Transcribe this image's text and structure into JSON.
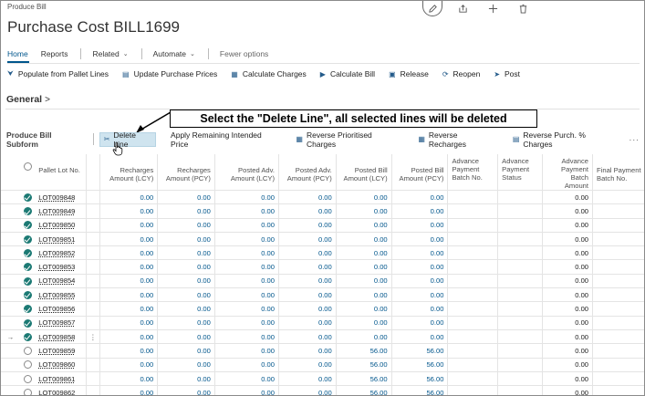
{
  "breadcrumb": "Produce Bill",
  "page_title": "Purchase Cost BILL1699",
  "menu": {
    "home": "Home",
    "reports": "Reports",
    "related": "Related",
    "automate": "Automate",
    "fewer": "Fewer options"
  },
  "actions": [
    {
      "label": "Populate from Pallet Lines",
      "icon": "populate-icon"
    },
    {
      "label": "Update Purchase Prices",
      "icon": "update-prices-icon"
    },
    {
      "label": "Calculate Charges",
      "icon": "calculator-icon"
    },
    {
      "label": "Calculate Bill",
      "icon": "play-icon"
    },
    {
      "label": "Release",
      "icon": "release-icon"
    },
    {
      "label": "Reopen",
      "icon": "reopen-icon"
    },
    {
      "label": "Post",
      "icon": "post-icon"
    }
  ],
  "section": {
    "title": "General",
    "chevron": ">"
  },
  "callout": "Select the \"Delete Line\", all selected lines will be deleted",
  "subform": {
    "title": "Produce Bill Subform",
    "actions": [
      {
        "label": "Delete Line",
        "icon": "delete-line-icon"
      },
      {
        "label": "Apply Remaining Intended Price",
        "icon": ""
      },
      {
        "label": "Reverse Prioritised Charges",
        "icon": "reverse-icon"
      },
      {
        "label": "Reverse Recharges",
        "icon": "reverse-icon"
      },
      {
        "label": "Reverse Purch. % Charges",
        "icon": "reverse-percent-icon"
      }
    ],
    "more": "···"
  },
  "table": {
    "headers": [
      "Pallet Lot No.",
      "Recharges Amount (LCY)",
      "Recharges Amount (PCY)",
      "Posted Adv. Amount (LCY)",
      "Posted Adv. Amount (PCY)",
      "Posted Bill Amount (LCY)",
      "Posted Bill Amount (PCY)",
      "Advance Payment Batch No.",
      "Advance Payment Status",
      "Advance Payment Batch Amount",
      "Final Payment Batch No."
    ],
    "rows": [
      {
        "selected": true,
        "current": false,
        "lot": "LOT009848",
        "v": [
          "0.00",
          "0.00",
          "0.00",
          "0.00",
          "0.00",
          "0.00",
          "",
          "",
          "0.00",
          ""
        ]
      },
      {
        "selected": true,
        "current": false,
        "lot": "LOT009849",
        "v": [
          "0.00",
          "0.00",
          "0.00",
          "0.00",
          "0.00",
          "0.00",
          "",
          "",
          "0.00",
          ""
        ]
      },
      {
        "selected": true,
        "current": false,
        "lot": "LOT009850",
        "v": [
          "0.00",
          "0.00",
          "0.00",
          "0.00",
          "0.00",
          "0.00",
          "",
          "",
          "0.00",
          ""
        ]
      },
      {
        "selected": true,
        "current": false,
        "lot": "LOT009851",
        "v": [
          "0.00",
          "0.00",
          "0.00",
          "0.00",
          "0.00",
          "0.00",
          "",
          "",
          "0.00",
          ""
        ]
      },
      {
        "selected": true,
        "current": false,
        "lot": "LOT009852",
        "v": [
          "0.00",
          "0.00",
          "0.00",
          "0.00",
          "0.00",
          "0.00",
          "",
          "",
          "0.00",
          ""
        ]
      },
      {
        "selected": true,
        "current": false,
        "lot": "LOT009853",
        "v": [
          "0.00",
          "0.00",
          "0.00",
          "0.00",
          "0.00",
          "0.00",
          "",
          "",
          "0.00",
          ""
        ]
      },
      {
        "selected": true,
        "current": false,
        "lot": "LOT009854",
        "v": [
          "0.00",
          "0.00",
          "0.00",
          "0.00",
          "0.00",
          "0.00",
          "",
          "",
          "0.00",
          ""
        ]
      },
      {
        "selected": true,
        "current": false,
        "lot": "LOT009855",
        "v": [
          "0.00",
          "0.00",
          "0.00",
          "0.00",
          "0.00",
          "0.00",
          "",
          "",
          "0.00",
          ""
        ]
      },
      {
        "selected": true,
        "current": false,
        "lot": "LOT009856",
        "v": [
          "0.00",
          "0.00",
          "0.00",
          "0.00",
          "0.00",
          "0.00",
          "",
          "",
          "0.00",
          ""
        ]
      },
      {
        "selected": true,
        "current": false,
        "lot": "LOT009857",
        "v": [
          "0.00",
          "0.00",
          "0.00",
          "0.00",
          "0.00",
          "0.00",
          "",
          "",
          "0.00",
          ""
        ]
      },
      {
        "selected": true,
        "current": true,
        "lot": "LOT009858",
        "v": [
          "0.00",
          "0.00",
          "0.00",
          "0.00",
          "0.00",
          "0.00",
          "",
          "",
          "0.00",
          ""
        ]
      },
      {
        "selected": false,
        "current": false,
        "lot": "LOT009859",
        "v": [
          "0.00",
          "0.00",
          "0.00",
          "0.00",
          "56.00",
          "56.00",
          "",
          "",
          "0.00",
          ""
        ]
      },
      {
        "selected": false,
        "current": false,
        "lot": "LOT009860",
        "v": [
          "0.00",
          "0.00",
          "0.00",
          "0.00",
          "56.00",
          "56.00",
          "",
          "",
          "0.00",
          ""
        ]
      },
      {
        "selected": false,
        "current": false,
        "lot": "LOT009861",
        "v": [
          "0.00",
          "0.00",
          "0.00",
          "0.00",
          "56.00",
          "56.00",
          "",
          "",
          "0.00",
          ""
        ]
      },
      {
        "selected": false,
        "current": false,
        "lot": "LOT009862",
        "v": [
          "0.00",
          "0.00",
          "0.00",
          "0.00",
          "56.00",
          "56.00",
          "",
          "",
          "0.00",
          ""
        ]
      }
    ],
    "current_row_marker": "→",
    "row_menu": "⋮"
  }
}
